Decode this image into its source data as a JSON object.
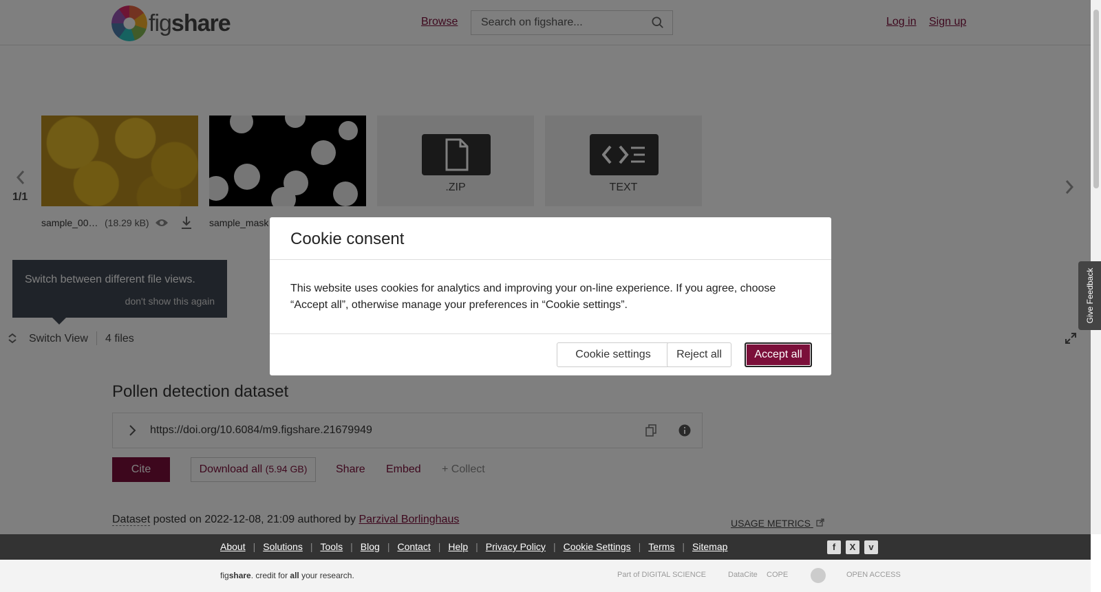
{
  "header": {
    "logo_text_a": "fig",
    "logo_text_b": "share",
    "browse": "Browse",
    "search_placeholder": "Search on figshare...",
    "login": "Log in",
    "signup": "Sign up"
  },
  "gallery": {
    "pager": "1/1",
    "files": [
      {
        "name": "sample_00…",
        "size": "(18.29 kB)"
      },
      {
        "name": "sample_mask"
      },
      {
        "type_label": ".ZIP",
        "icon": "file-icon"
      },
      {
        "type_label": "TEXT",
        "icon": "code-icon"
      }
    ],
    "tooltip_text": "Switch between different file views.",
    "tooltip_dismiss": "don't show this again",
    "switch_view": "Switch View",
    "files_count": "4 files"
  },
  "item": {
    "title": "Pollen detection dataset",
    "doi": "https://doi.org/10.6084/m9.figshare.21679949",
    "cite": "Cite",
    "download_all": "Download all",
    "download_size": "(5.94 GB)",
    "share": "Share",
    "embed": "Embed",
    "collect": "+ Collect",
    "type": "Dataset",
    "posted_text": " posted on 2022-12-08, 21:09 authored by ",
    "author": "Parzival Borlinghaus",
    "usage_metrics": "USAGE METRICS"
  },
  "footer": {
    "links": [
      "About",
      "Solutions",
      "Tools",
      "Blog",
      "Contact",
      "Help",
      "Privacy Policy",
      "Cookie Settings",
      "Terms",
      "Sitemap"
    ],
    "social": [
      "facebook-icon",
      "x-icon",
      "vimeo-icon"
    ],
    "tagline_a": "fig",
    "tagline_b": "share",
    "tagline_c": ". credit for ",
    "tagline_d": "all",
    "tagline_e": " your research.",
    "partners": [
      "Part of DIGITAL SCIENCE",
      "DataCite",
      "COPE",
      "",
      "OPEN ACCESS"
    ]
  },
  "feedback": "Give Feedback",
  "cookie_modal": {
    "title": "Cookie consent",
    "body": "This website uses cookies for analytics and improving your on-line experience. If you agree, choose “Accept all”, otherwise manage your preferences in “Cookie settings”.",
    "settings": "Cookie settings",
    "reject": "Reject all",
    "accept": "Accept all"
  },
  "colors": {
    "brand": "#7b0f3a",
    "footer_dark": "#333333"
  }
}
